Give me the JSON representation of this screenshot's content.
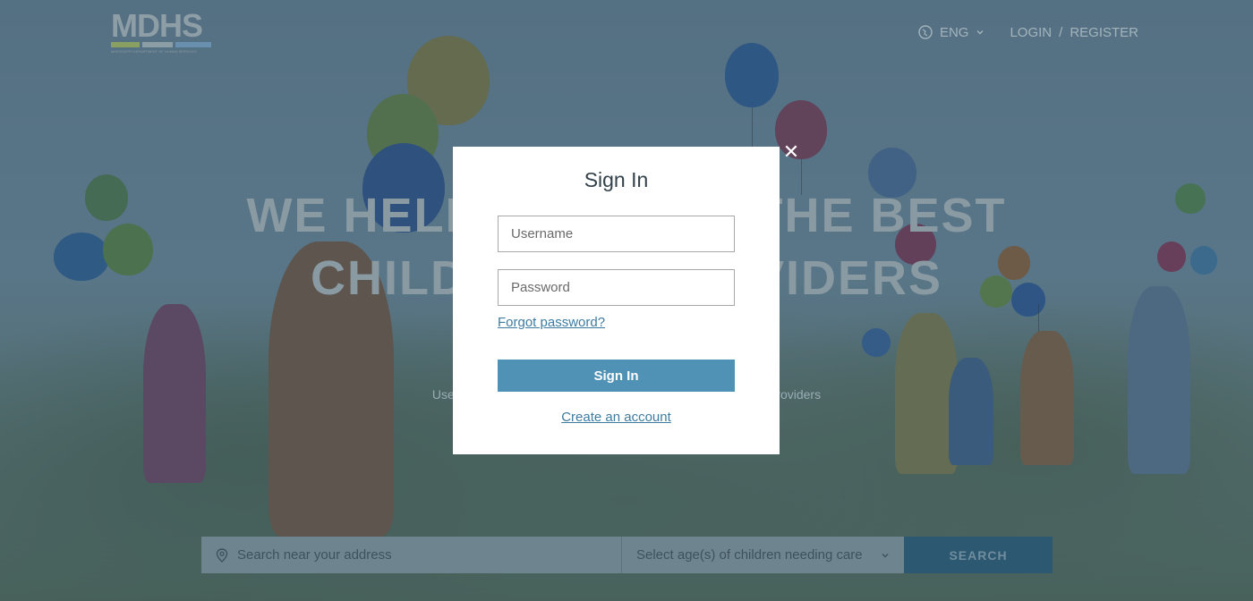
{
  "header": {
    "logo_text": "MDHS",
    "logo_tagline": "MISSISSIPPI DEPARTMENT OF HUMAN SERVICES",
    "language": "ENG",
    "login_label": "LOGIN",
    "separator": "/",
    "register_label": "REGISTER"
  },
  "hero": {
    "title_line1": "WE HELP YOU FIND THE BEST",
    "title_line2": "CHILD CARE PROVIDERS",
    "subtitle": "Use filters to narrow your search and find the best child care providers"
  },
  "search": {
    "address_placeholder": "Search near your address",
    "age_select_value": "Select age(s) of children needing care",
    "button_label": "SEARCH"
  },
  "modal": {
    "title": "Sign In",
    "username_placeholder": "Username",
    "password_placeholder": "Password",
    "forgot_label": "Forgot password?",
    "signin_label": "Sign In",
    "create_label": "Create an account",
    "close_symbol": "✕"
  },
  "colors": {
    "overlay": "#30485a",
    "primary_button": "#5091b6",
    "link": "#3d7ca0",
    "search_button": "#2c5872"
  }
}
